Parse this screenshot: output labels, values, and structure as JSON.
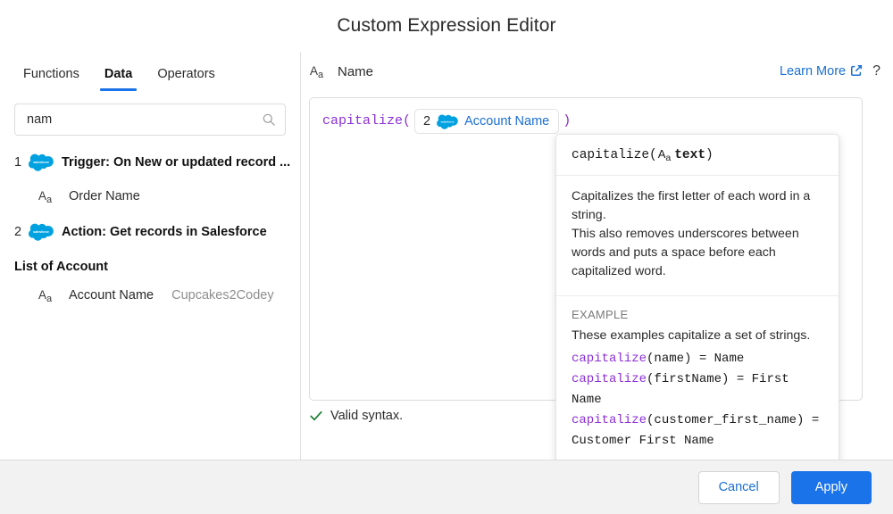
{
  "window": {
    "title": "Custom Expression Editor"
  },
  "sidebar": {
    "tabs": [
      {
        "label": "Functions",
        "active": false
      },
      {
        "label": "Data",
        "active": true
      },
      {
        "label": "Operators",
        "active": false
      }
    ],
    "search": {
      "value": "nam",
      "placeholder": "Search",
      "icon": "search-icon"
    },
    "tree": {
      "step1": {
        "number": "1",
        "icon": "salesforce-cloud-icon",
        "label": "Trigger: On New or updated record ..."
      },
      "step1_field": {
        "type_icon": "text-type-icon",
        "label": "Order Name"
      },
      "step2": {
        "number": "2",
        "icon": "salesforce-cloud-icon",
        "label": "Action: Get records in Salesforce"
      },
      "group_label": "List of Account",
      "step2_field": {
        "type_icon": "text-type-icon",
        "label": "Account Name",
        "sample": "Cupcakes2Codey"
      }
    }
  },
  "main": {
    "output": {
      "type_icon": "text-type-icon",
      "label": "Name"
    },
    "learn_more": "Learn More",
    "learn_more_icon": "external-link-icon",
    "help_icon": "?",
    "expression": {
      "function_name": "capitalize",
      "open_paren": "(",
      "close_paren": ")",
      "chip": {
        "number": "2",
        "icon": "salesforce-cloud-icon",
        "label": "Account Name"
      }
    },
    "validity": {
      "icon": "check-icon",
      "text": "Valid syntax."
    }
  },
  "popover": {
    "signature_prefix": "capitalize(",
    "signature_arg": "text",
    "signature_suffix": ")",
    "description_line1": "Capitalizes the first letter of each word in a string.",
    "description_line2": "This also removes underscores between words and puts a space before each capitalized word.",
    "example_title": "EXAMPLE",
    "example_desc": "These examples capitalize a set of strings.",
    "examples": [
      {
        "fn": "capitalize",
        "args": "(name)",
        "result": " = Name"
      },
      {
        "fn": "capitalize",
        "args": "(firstName)",
        "result": " = First Name"
      },
      {
        "fn": "capitalize",
        "args": "(customer_first_name)",
        "result": " = Customer First Name"
      }
    ]
  },
  "footer": {
    "cancel_label": "Cancel",
    "apply_label": "Apply"
  },
  "colors": {
    "accent_blue": "#1a73e8",
    "link_blue": "#1a6fd4",
    "function_purple": "#8b2fd6",
    "valid_green": "#1a7a33",
    "salesforce_blue": "#00a1e0",
    "footer_bg": "#f2f2f2"
  }
}
